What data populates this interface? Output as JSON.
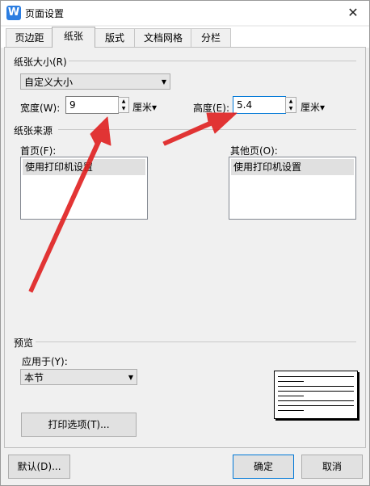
{
  "window": {
    "title": "页面设置",
    "close_glyph": "✕",
    "app_icon_letter": "W"
  },
  "tabs": [
    {
      "label": "页边距"
    },
    {
      "label": "纸张"
    },
    {
      "label": "版式"
    },
    {
      "label": "文档网格"
    },
    {
      "label": "分栏"
    }
  ],
  "paper_size": {
    "group_label": "纸张大小(R)",
    "selected": "自定义大小",
    "width_label": "宽度(W):",
    "width_value": "9",
    "width_unit": "厘米▾",
    "height_label": "高度(E):",
    "height_value": "5.4",
    "height_unit": "厘米▾"
  },
  "paper_source": {
    "group_label": "纸张来源",
    "first_page_label": "首页(F):",
    "first_page_item": "使用打印机设置",
    "other_pages_label": "其他页(O):",
    "other_pages_item": "使用打印机设置"
  },
  "preview": {
    "group_label": "预览",
    "apply_to_label": "应用于(Y):",
    "apply_to_value": "本节",
    "print_options_label": "打印选项(T)..."
  },
  "footer": {
    "default_label": "默认(D)...",
    "ok_label": "确定",
    "cancel_label": "取消"
  },
  "colors": {
    "accent": "#0078d7",
    "annotation": "#e02020",
    "app_icon": "#2b7de1"
  }
}
